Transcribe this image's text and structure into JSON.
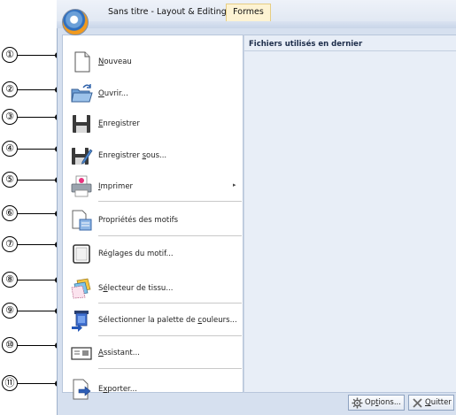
{
  "window": {
    "title": "Sans titre - Layout & Editing",
    "tab_label": "Formes"
  },
  "recent": {
    "header": "Fichiers utilisés en dernier"
  },
  "callouts": [
    "①",
    "②",
    "③",
    "④",
    "⑤",
    "⑥",
    "⑦",
    "⑧",
    "⑨",
    "⑩",
    "⑪"
  ],
  "menu": [
    {
      "pre": "",
      "ul": "N",
      "post": "ouveau",
      "icon": "new-document-icon"
    },
    {
      "pre": "",
      "ul": "O",
      "post": "uvrir...",
      "icon": "open-folder-icon"
    },
    {
      "pre": "",
      "ul": "E",
      "post": "nregistrer",
      "icon": "save-icon"
    },
    {
      "pre": "Enregistrer ",
      "ul": "s",
      "post": "ous...",
      "icon": "save-as-icon"
    },
    {
      "pre": "",
      "ul": "I",
      "post": "mprimer",
      "icon": "printer-icon",
      "submenu": "▸"
    },
    {
      "pre": "Propriétés des motifs",
      "ul": "",
      "post": "",
      "icon": "design-properties-icon"
    },
    {
      "pre": "Réglages du motif...",
      "ul": "",
      "post": "",
      "icon": "design-settings-icon"
    },
    {
      "pre": "S",
      "ul": "é",
      "post": "lecteur de tissu...",
      "icon": "fabric-selector-icon"
    },
    {
      "pre": "Sélectionner la palette de ",
      "ul": "c",
      "post": "ouleurs...",
      "icon": "color-palette-icon"
    },
    {
      "pre": "",
      "ul": "A",
      "post": "ssistant...",
      "icon": "wizard-icon"
    },
    {
      "pre": "E",
      "ul": "x",
      "post": "porter...",
      "icon": "export-icon"
    }
  ],
  "footer": {
    "options_pre": "Op",
    "options_ul": "t",
    "options_post": "ions...",
    "quit_ul": "Q",
    "quit_post": "uitter"
  }
}
